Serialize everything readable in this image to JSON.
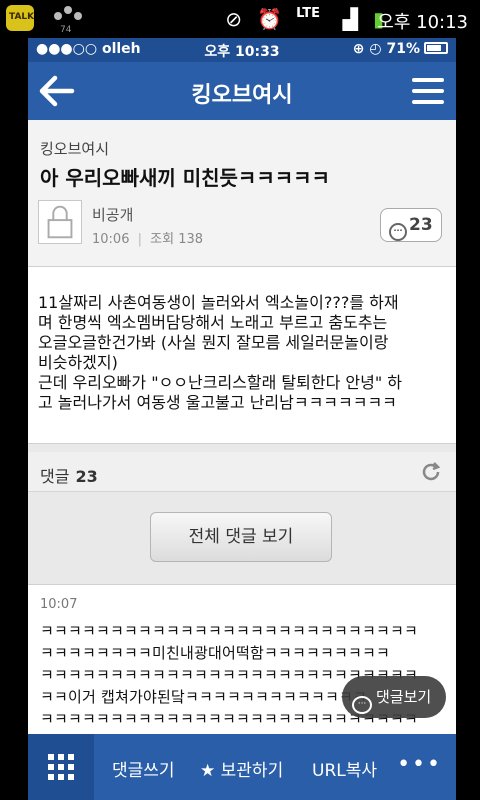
{
  "os_status": {
    "kakao_label": "TALK",
    "notif_count": "74",
    "time": "오후 10:13",
    "network": "LTE"
  },
  "ios_status": {
    "carrier": "●●●○○ olleh",
    "time": "오후 10:33",
    "battery": "71%"
  },
  "nav": {
    "title": "킹오브여시"
  },
  "post": {
    "cafe_name": "킹오브여시",
    "title": "아 우리오빠새끼 미친듯ㅋㅋㅋㅋㅋ",
    "author": "비공개",
    "time": "10:06",
    "views": "조회 138",
    "comment_count": "23",
    "body": "11살짜리 사촌여동생이 놀러와서 엑소놀이???를 하재\n며 한명씩 엑소멤버담당해서 노래고 부르고 춤도추는\n오글오글한건가봐 (사실 뭔지 잘모름 세일러문놀이랑\n비슷하겠지)\n근데 우리오빠가 \"ㅇㅇ난크리스할래 탈퇴한다 안녕\" 하\n고 놀러나가서 여동생 울고불고 난리남ㅋㅋㅋㅋㅋㅋㅋ"
  },
  "comments_bar": {
    "label": "댓글",
    "count": "23"
  },
  "all_comments_button": "전체 댓글 보기",
  "comment": {
    "time": "10:07",
    "lines": [
      "ㅋㅋㅋㅋㅋㅋㅋㅋㅋㅋㅋㅋㅋㅋㅋㅋㅋㅋㅋㅋㅋㅋㅋㅋㅋㅋㅋ",
      "ㅋㅋㅋㅋㅋㅋㅋㅋ미친내광대어떡함ㅋㅋㅋㅋㅋㅋㅋㅋㅋ",
      "ㅋㅋㅋㅋㅋㅋㅋㅋㅋㅋㅋㅋㅋㅋㅋㅋㅋㅋㅋㅋㅋㅋㅋㅋㅋㅋㅋ",
      "ㅋㅋ이거 캡쳐가야된닼ㅋㅋㅋㅋㅋㅋㅋㅋㅋㅋㅋㅋㅋ",
      "ㅋㅋㅋㅋㅋㅋㅋㅋㅋㅋㅋㅋㅋㅋㅋㅋㅋㅋㅋㅋㅋㅋㅋㅋㅋㅋㅋ"
    ]
  },
  "floating_button": "댓글보기",
  "bottom_bar": {
    "write": "댓글쓰기",
    "save": "보관하기",
    "copy": "URL복사",
    "more": "•••"
  },
  "colors": {
    "nav_blue": "#2a5ea8",
    "status_blue": "#1f4e92"
  }
}
